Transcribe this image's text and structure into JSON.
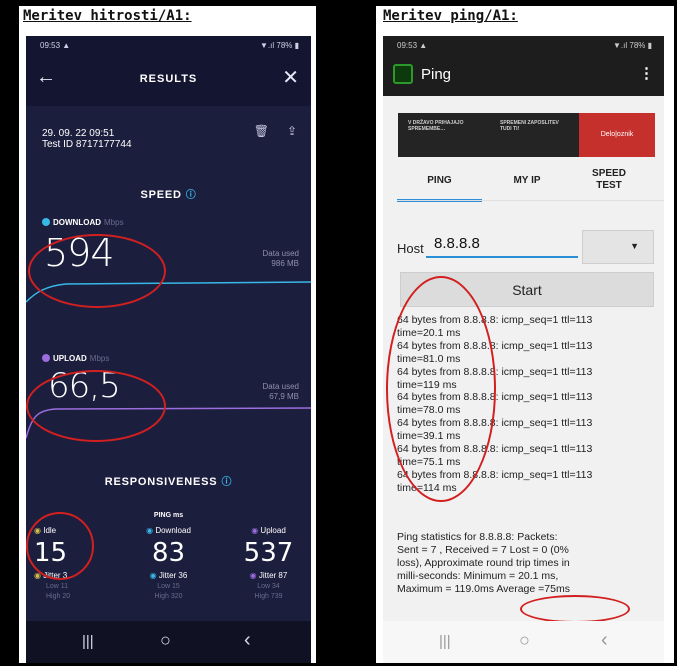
{
  "left": {
    "caption": "Meritev hitrosti/A1:",
    "status": {
      "time": "09:53 ▲",
      "right": "▼.ıl 78% ▮"
    },
    "header": {
      "title": "RESULTS",
      "back_icon": "arrow-left-icon",
      "close_icon": "close-icon"
    },
    "meta": {
      "datetime": "29. 09. 22 09:51",
      "test_id": "Test ID 8717177744"
    },
    "speed": {
      "title": "SPEED",
      "download": {
        "label": "DOWNLOAD",
        "unit": "Mbps",
        "value": "594",
        "data_used_label": "Data used",
        "data_used": "986 MB",
        "color": "#37b8e6"
      },
      "upload": {
        "label": "UPLOAD",
        "unit": "Mbps",
        "value": "66,5",
        "data_used_label": "Data used",
        "data_used": "67,9 MB",
        "color": "#9b6dde"
      }
    },
    "responsiveness": {
      "title": "RESPONSIVENESS",
      "ping_label": "PING ms",
      "columns": [
        {
          "label": "Idle",
          "value": "15",
          "jitter": "Jitter 3",
          "low": "Low 11",
          "high": "High 20",
          "color": "#d2c04a"
        },
        {
          "label": "Download",
          "value": "83",
          "jitter": "Jitter 36",
          "low": "Low 15",
          "high": "High 320",
          "color": "#37b8e6"
        },
        {
          "label": "Upload",
          "value": "537",
          "jitter": "Jitter 87",
          "low": "Low 34",
          "high": "High 739",
          "color": "#9b6dde"
        }
      ]
    },
    "nav": {
      "recent": "|||",
      "home": "○",
      "back": "‹"
    }
  },
  "right": {
    "caption": "Meritev ping/A1:",
    "status": {
      "time": "09:53 ▲",
      "right": "▼.ıl 78% ▮"
    },
    "app_title": "Ping",
    "ad": {
      "col1": "V DRŽAVO PRIHAJAJO SPREMEMBE…",
      "col2": "SPREMENI ZAPOSLITEV TUDI TI!",
      "brand": "Delo|oznik"
    },
    "tabs": [
      "PING",
      "MY IP",
      "SPEED TEST"
    ],
    "host": {
      "label": "Host",
      "value": "8.8.8.8"
    },
    "start_label": "Start",
    "ping_lines": [
      "64 bytes from 8.8.8.8: icmp_seq=1 ttl=113",
      "time=20.1 ms",
      "64 bytes from 8.8.8.8: icmp_seq=1 ttl=113",
      "time=81.0 ms",
      "64 bytes from 8.8.8.8: icmp_seq=1 ttl=113",
      "time=119 ms",
      "64 bytes from 8.8.8.8: icmp_seq=1 ttl=113",
      "time=78.0 ms",
      "64 bytes from 8.8.8.8: icmp_seq=1 ttl=113",
      "time=39.1 ms",
      "64 bytes from 8.8.8.8: icmp_seq=1 ttl=113",
      "time=75.1 ms",
      "64 bytes from 8.8.8.8: icmp_seq=1 ttl=113",
      "time=114 ms"
    ],
    "stats": {
      "line1": "Ping statistics for 8.8.8.8: Packets:",
      "line2": "Sent = 7 , Received = 7 Lost = 0 (0%",
      "line3": "loss), Approximate round trip times in",
      "line4": "milli-seconds:   Minimum = 20.1 ms,",
      "line5a": "Maximum = 119.0ms",
      "line5b": "Average =75ms"
    },
    "nav": {
      "recent": "|||",
      "home": "○",
      "back": "‹"
    }
  }
}
